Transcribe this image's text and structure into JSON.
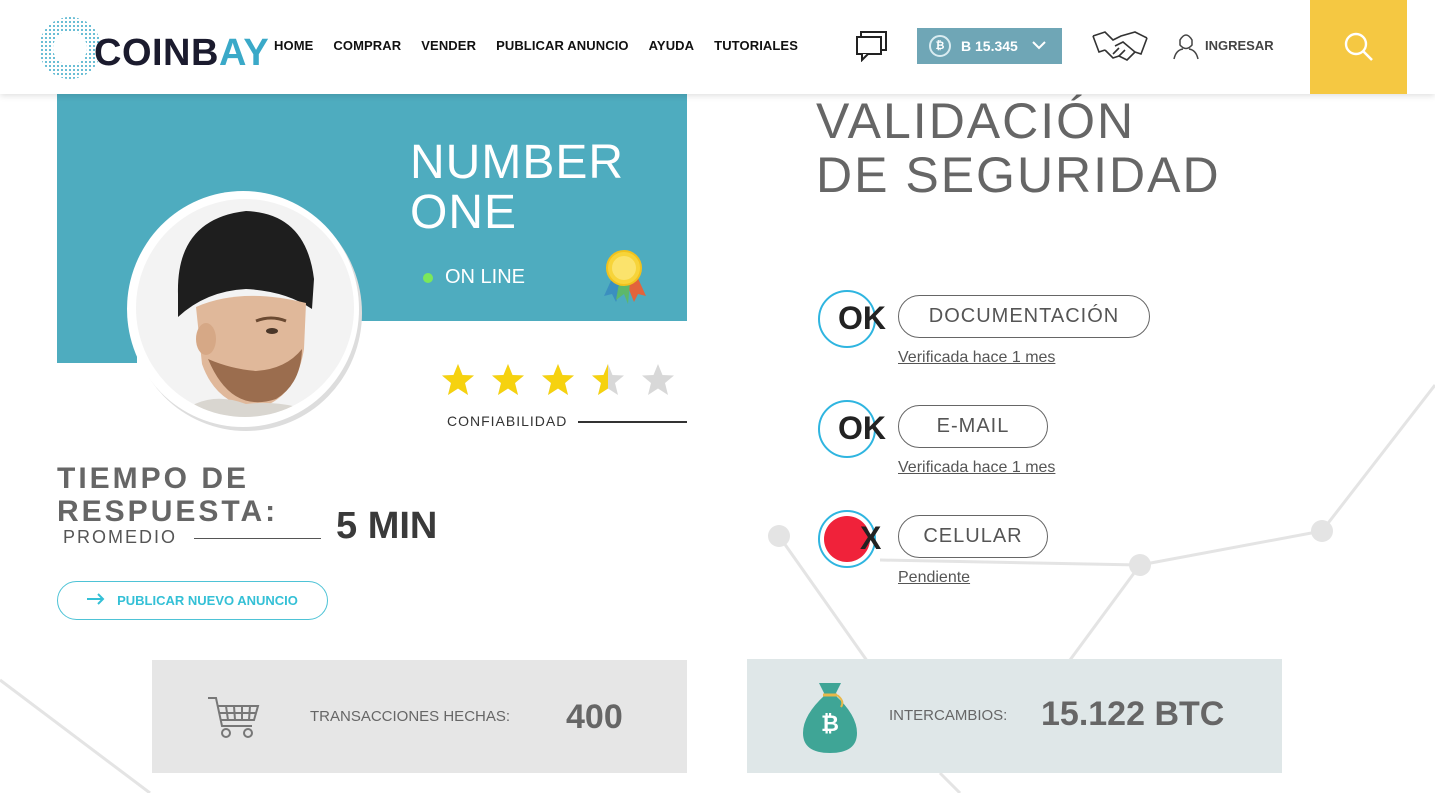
{
  "header": {
    "logo_text_left": "COINB",
    "logo_text_accent": "AY",
    "nav": [
      "HOME",
      "COMPRAR",
      "VENDER",
      "PUBLICAR ANUNCIO",
      "AYUDA",
      "TUTORIALES"
    ],
    "btc_balance": "B 15.345",
    "login_label": "INGRESAR",
    "icons": [
      "chat-icon",
      "bitcoin-coin-icon",
      "chevron-down-icon",
      "handshake-icon",
      "user-icon",
      "search-icon"
    ]
  },
  "profile": {
    "name_line1": "NUMBER",
    "name_line2": "ONE",
    "status": "ON LINE",
    "rating": 3.5,
    "rating_max": 5,
    "rating_label": "CONFIABILIDAD",
    "response_title_line1": "TIEMPO DE",
    "response_title_line2": "RESPUESTA:",
    "response_sub": "PROMEDIO",
    "response_value": "5 MIN",
    "publish_button": "PUBLICAR NUEVO ANUNCIO"
  },
  "validation": {
    "title_line1": "VALIDACIÓN",
    "title_line2": "DE SEGURIDAD",
    "items": [
      {
        "mark": "OK",
        "label": "DOCUMENTACIÓN",
        "status": "Verificada hace 1 mes",
        "state": "ok"
      },
      {
        "mark": "OK",
        "label": "E-MAIL",
        "status": "Verificada hace 1 mes",
        "state": "ok"
      },
      {
        "mark": "X",
        "label": "CELULAR",
        "status": "Pendiente",
        "state": "pending"
      }
    ]
  },
  "stats": {
    "transactions_label": "TRANSACCIONES HECHAS:",
    "transactions_value": "400",
    "exchanges_label": "INTERCAMBIOS:",
    "exchanges_value": "15.122 BTC"
  },
  "colors": {
    "brand_teal": "#4eacbf",
    "accent_yellow": "#f5c842",
    "ok_ring": "#2fb5e0",
    "pending_red": "#f0223a"
  }
}
